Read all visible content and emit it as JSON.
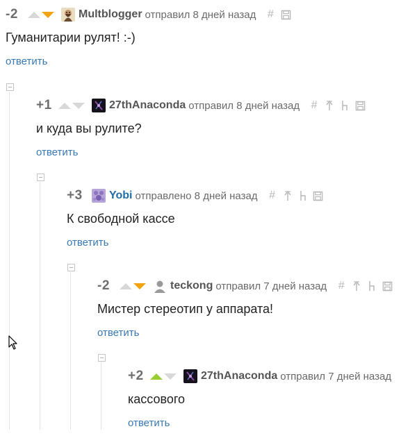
{
  "comments": [
    {
      "score": "-2",
      "vote": "down",
      "avatar": "bearded-user-avatar",
      "user": "Multblogger",
      "user_blue": false,
      "meta": "отправил 8 дней назад",
      "tools": [
        "hash-icon",
        "save-icon"
      ],
      "text": "Гуманитарии рулят! :-)",
      "reply": "ответить"
    },
    {
      "score": "+1",
      "vote": "none",
      "avatar": "dark-cosmic-avatar",
      "user": "27thAnaconda",
      "user_blue": false,
      "meta": "отправил 8 дней назад",
      "tools": [
        "hash-icon",
        "parent-icon",
        "thread-icon",
        "save-icon"
      ],
      "text": "и куда вы рулите?",
      "reply": "ответить"
    },
    {
      "score": "+3",
      "vote": "none",
      "avatar": "purple-pattern-avatar",
      "user": "Yobi",
      "user_blue": true,
      "meta": "отправлено 8 дней назад",
      "tools": [
        "hash-icon",
        "parent-icon",
        "thread-icon",
        "save-icon"
      ],
      "text": "К свободной кассе",
      "reply": "ответить"
    },
    {
      "score": "-2",
      "vote": "down",
      "avatar": "default-user-silhouette-avatar",
      "user": "teckong",
      "user_blue": false,
      "meta": "отправил 7 дней назад",
      "tools": [
        "hash-icon",
        "parent-icon",
        "thread-icon",
        "save-icon"
      ],
      "text": "Мистер стереотип у аппарата!",
      "reply": "ответить"
    },
    {
      "score": "+2",
      "vote": "up",
      "avatar": "dark-cosmic-avatar",
      "user": "27thAnaconda",
      "user_blue": false,
      "meta": "отправил 7 дней назад",
      "tools": [],
      "text": "кассового",
      "reply": "ответить"
    }
  ],
  "colors": {
    "upvote_active": "#9acd32",
    "downvote_active": "#f2a310",
    "vote_inactive": "#d8d8d8",
    "reply_link": "#3878b4",
    "username_blue": "#1f6fa8"
  }
}
